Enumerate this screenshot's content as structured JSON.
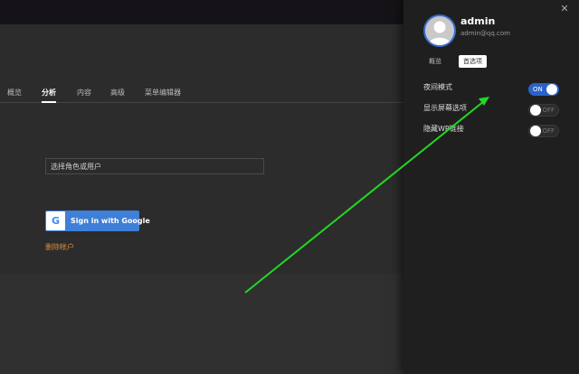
{
  "main": {
    "tabs": [
      {
        "label": "概览"
      },
      {
        "label": "分析"
      },
      {
        "label": "内容"
      },
      {
        "label": "高级"
      },
      {
        "label": "菜单编辑器"
      }
    ],
    "role_select": {
      "placeholder": "选择角色或用户"
    },
    "google_button": {
      "label": "Sign in with Google"
    },
    "delete_link": "删除帐户"
  },
  "panel": {
    "user": {
      "name": "admin",
      "email": "admin@qq.com"
    },
    "tabs": [
      {
        "label": "概览"
      },
      {
        "label": "首选项"
      }
    ],
    "settings": [
      {
        "label": "夜间模式",
        "state": "ON"
      },
      {
        "label": "显示屏幕选项",
        "state": "OFF"
      },
      {
        "label": "隐藏WP链接",
        "state": "OFF"
      }
    ]
  },
  "colors": {
    "accent": "#2a62c9",
    "arrow": "#22d822",
    "link": "#d98c3a"
  }
}
